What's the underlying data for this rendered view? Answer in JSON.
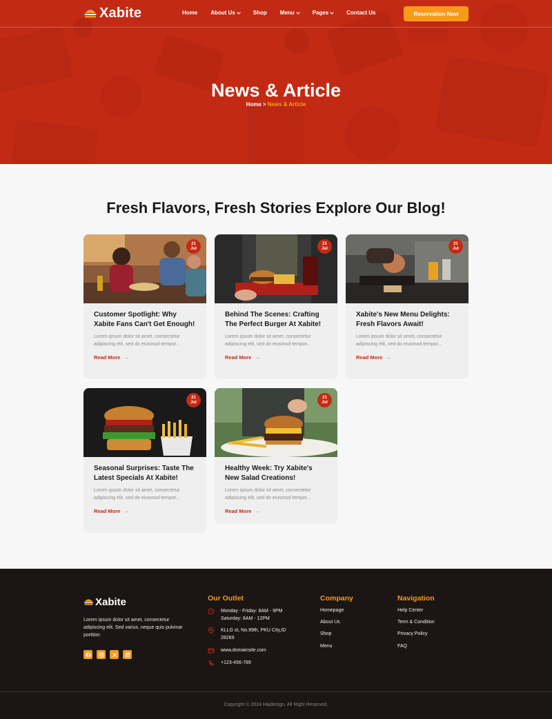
{
  "brand": {
    "name": "Xabite",
    "accent": "#c42a14",
    "secondary": "#f79a1a"
  },
  "nav": {
    "items": [
      {
        "label": "Home",
        "dropdown": false
      },
      {
        "label": "About Us",
        "dropdown": true
      },
      {
        "label": "Shop",
        "dropdown": false
      },
      {
        "label": "Menu",
        "dropdown": true
      },
      {
        "label": "Pages",
        "dropdown": true
      },
      {
        "label": "Contact Us",
        "dropdown": false
      }
    ],
    "cta": "Reservation Now"
  },
  "hero": {
    "title": "News & Article",
    "breadcrumb": {
      "home": "Home",
      "separator": ">",
      "current": "News & Article"
    }
  },
  "blog": {
    "heading": "Fresh Flavors, Fresh Stories Explore Our Blog!",
    "posts": [
      {
        "day": "21",
        "month": "Jul",
        "title": "Customer Spotlight: Why Xabite Fans Can't Get Enough!",
        "excerpt": "Lorem ipsum dolor sit amet, consectetur adipiscing elit, sed do eiusmod tempor...",
        "read_more": "Read More",
        "image": "friends-dining-photo"
      },
      {
        "day": "21",
        "month": "Jul",
        "title": "Behind The Scenes: Crafting The Perfect Burger At Xabite!",
        "excerpt": "Lorem ipsum dolor sit amet, consectetur adipiscing elit, sed do eiusmod tempor...",
        "read_more": "Read More",
        "image": "burger-fries-tray-photo"
      },
      {
        "day": "21",
        "month": "Jul",
        "title": "Xabite's New Menu Delights: Fresh Flavors Await!",
        "excerpt": "Lorem ipsum dolor sit amet, consectetur adipiscing elit, sed do eiusmod tempor...",
        "read_more": "Read More",
        "image": "kitchen-chef-photo"
      },
      {
        "day": "21",
        "month": "Jul",
        "title": "Seasonal Surprises: Taste The Latest Specials At Xabite!",
        "excerpt": "Lorem ipsum dolor sit amet, consectetur adipiscing elit, sed do eiusmod tempor...",
        "read_more": "Read More",
        "image": "burger-fries-cup-photo"
      },
      {
        "day": "21",
        "month": "Jul",
        "title": "Healthy Week: Try Xabite's New Salad Creations!",
        "excerpt": "Lorem ipsum dolor sit amet, consectetur adipiscing elit, sed do eiusmod tempor...",
        "read_more": "Read More",
        "image": "burger-plate-photo"
      }
    ]
  },
  "footer": {
    "about": "Lorem ipsum dolor sit amet, consectetur adipiscing elit. Sed varius, neque quis pulvinar porttitor.",
    "socials": [
      "facebook-icon",
      "instagram-icon",
      "x-icon",
      "linkedin-icon"
    ],
    "outlet": {
      "title": "Our Outlet",
      "hours_line1": "Monday - Friday: 8AM - 9PM",
      "hours_line2": "Saturday: 8AM - 12PM",
      "address_line1": "KLLG st, No.99th, PKU City,ID",
      "address_line2": "28289",
      "website": "www.domainsite.com",
      "phone": "+123-456-789"
    },
    "company": {
      "title": "Company",
      "links": [
        "Homepage",
        "About Us",
        "Shop",
        "Menu"
      ]
    },
    "navigation": {
      "title": "Navigation",
      "links": [
        "Help Center",
        "Term & Condition",
        "Privacy Policy",
        "FAQ"
      ]
    },
    "copyright": "Copyright © 2024 Haidezign. All Right Reserved."
  }
}
